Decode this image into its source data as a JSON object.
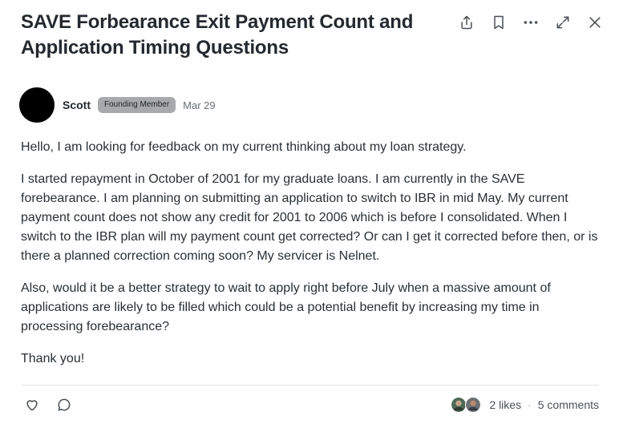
{
  "post": {
    "title": "SAVE Forbearance Exit Payment Count and Application Timing Questions",
    "author": "Scott",
    "badge": "Founding Member",
    "date": "Mar 29",
    "paragraphs": [
      "Hello, I am looking for feedback on my current thinking about my loan strategy.",
      "I started repayment in October of 2001 for my graduate loans. I am currently in the SAVE forebearance. I am planning on submitting an application to switch to IBR in mid May. My current payment count does not show any credit for 2001 to 2006 which is before I consolidated. When I switch to the IBR plan will my payment count get corrected? Or can I get it corrected before then, or is there a planned correction coming soon? My servicer is Nelnet.",
      "Also, would it be a better strategy to wait to apply right before July when a massive amount of applications are likely to be filled which could be a potential benefit by increasing my time in processing forebearance?",
      "Thank you!"
    ]
  },
  "toolbar": {
    "icons": [
      "share-icon",
      "bookmark-icon",
      "more-icon",
      "expand-icon",
      "close-icon"
    ]
  },
  "footer": {
    "likes": "2 likes",
    "separator": "·",
    "comments": "5 comments",
    "icons": [
      "heart-icon",
      "comment-icon"
    ]
  },
  "colors": {
    "badge_bg": "#a7a9ac",
    "avatar": "#000000",
    "divider": "#e3e5e8"
  }
}
